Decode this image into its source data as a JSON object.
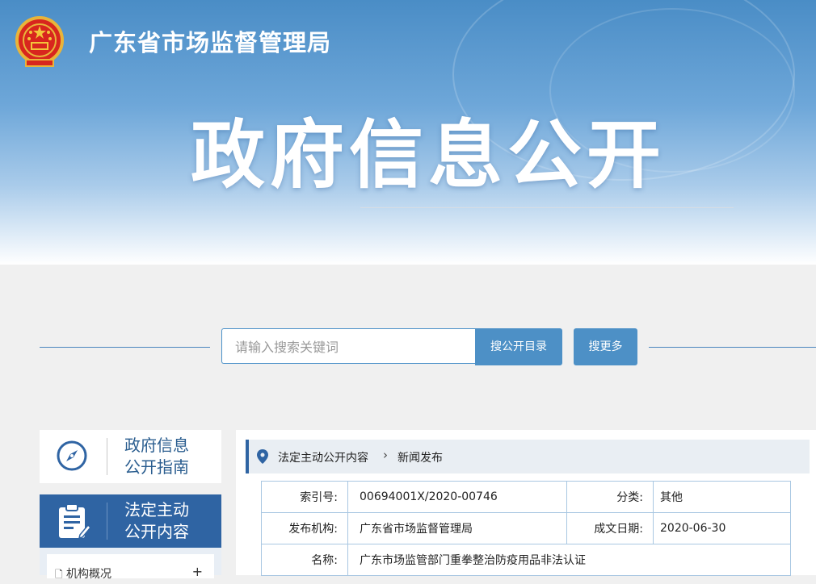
{
  "header": {
    "site_title": "广东省市场监督管理局",
    "hero_title": "政府信息公开"
  },
  "search": {
    "placeholder": "请输入搜索关键词",
    "catalog_button": "搜公开目录",
    "more_button": "搜更多"
  },
  "sidebar": {
    "guide": {
      "line1": "政府信息",
      "line2": "公开指南",
      "icon": "compass-icon"
    },
    "active": {
      "line1": "法定主动",
      "line2": "公开内容",
      "icon": "document-edit-icon"
    },
    "sub_items": [
      {
        "label": "机构概况",
        "toggle": "+"
      }
    ]
  },
  "breadcrumb": {
    "level1": "法定主动公开内容",
    "separator": "›",
    "level2": "新闻发布"
  },
  "info": {
    "index_label": "索引号:",
    "index_value": "00694001X/2020-00746",
    "category_label": "分类:",
    "category_value": "其他",
    "publisher_label": "发布机构:",
    "publisher_value": "广东省市场监督管理局",
    "date_label": "成文日期:",
    "date_value": "2020-06-30",
    "name_label": "名称:",
    "name_value": "广东市场监管部门重拳整治防疫用品非法认证"
  },
  "colors": {
    "primary_blue": "#2f64a3",
    "button_blue": "#4d90c6",
    "table_border": "#a9c7e2"
  }
}
